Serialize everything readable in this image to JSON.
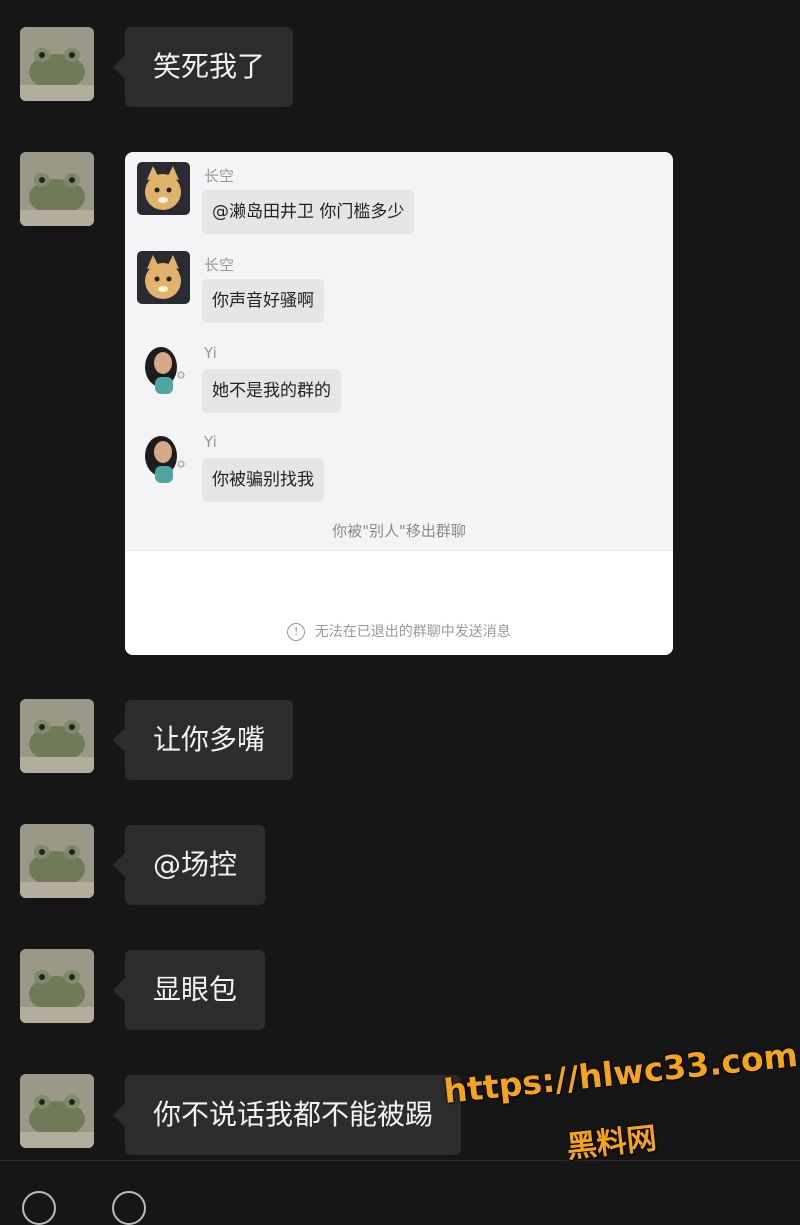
{
  "messages": [
    {
      "text": "笑死我了"
    },
    {
      "text": "让你多嘴"
    },
    {
      "text": "@场控"
    },
    {
      "text": "显眼包"
    },
    {
      "text": "你不说话我都不能被踢"
    }
  ],
  "screenshot": {
    "items": [
      {
        "name": "长空",
        "text": "@濑岛田井卫 你门槛多少"
      },
      {
        "name": "长空",
        "text": "你声音好骚啊"
      },
      {
        "name": "Yi",
        "text": "她不是我的群的"
      },
      {
        "name": "Yi",
        "text": "你被骗别找我"
      }
    ],
    "system_note": "你被\"别人\"移出群聊",
    "warning_icon": "!",
    "warning": "无法在已退出的群聊中发送消息"
  },
  "watermark": {
    "url": "https://hlwc33.com",
    "name": "黑料网"
  },
  "colors": {
    "background": "#161616",
    "bubble": "#2c2c2c",
    "watermark": "#f5a31a"
  }
}
